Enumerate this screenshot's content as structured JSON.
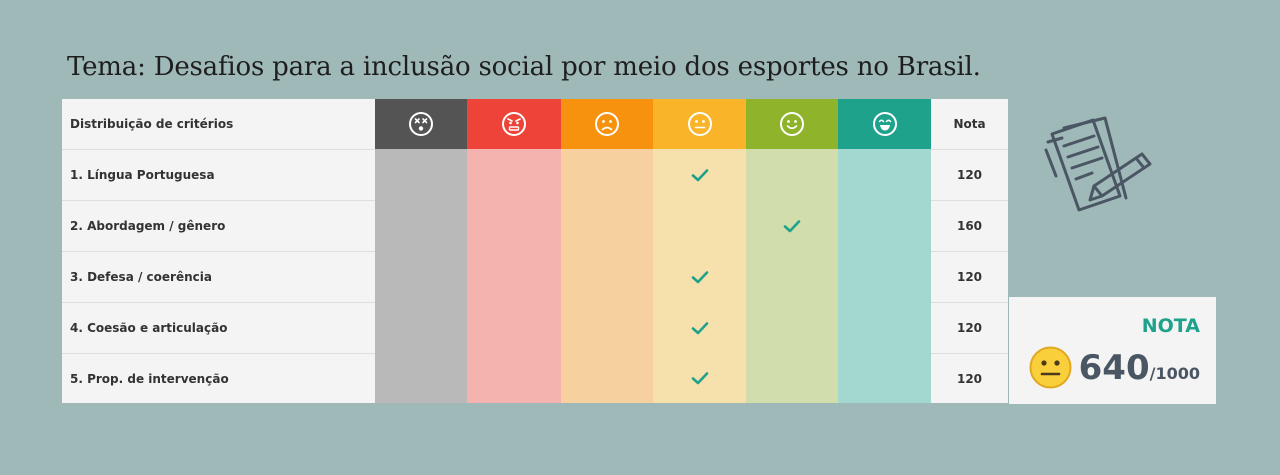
{
  "title": "Tema:  Desafios para a inclusão social por meio dos esportes no Brasil.",
  "table": {
    "header_label": "Distribuição de critérios",
    "nota_label": "Nota",
    "levels": [
      {
        "icon": "dizzy-face-icon",
        "header_color": "#545454",
        "cell_color": "#b9b9b9"
      },
      {
        "icon": "angry-face-icon",
        "header_color": "#ee4338",
        "cell_color": "#f4b3ae"
      },
      {
        "icon": "sad-face-icon",
        "header_color": "#f7920f",
        "cell_color": "#f7d09f"
      },
      {
        "icon": "neutral-face-icon",
        "header_color": "#f9b42a",
        "cell_color": "#f6e0ab"
      },
      {
        "icon": "smile-face-icon",
        "header_color": "#8fb32a",
        "cell_color": "#d1ddaa"
      },
      {
        "icon": "laugh-face-icon",
        "header_color": "#1ea28c",
        "cell_color": "#a3d8d0"
      }
    ],
    "rows": [
      {
        "label": "1. Língua Portuguesa",
        "checked_level": 3,
        "nota": "120"
      },
      {
        "label": "2. Abordagem / gênero",
        "checked_level": 4,
        "nota": "160"
      },
      {
        "label": "3. Defesa / coerência",
        "checked_level": 3,
        "nota": "120"
      },
      {
        "label": "4. Coesão e articulação",
        "checked_level": 3,
        "nota": "120"
      },
      {
        "label": "5. Prop. de intervenção",
        "checked_level": 3,
        "nota": "120"
      }
    ]
  },
  "summary": {
    "label": "NOTA",
    "score": "640",
    "max": "/1000",
    "icon": "neutral-face-icon"
  },
  "decor_icon": "notes-pencil-icon",
  "colors": {
    "background": "#9fb8b8",
    "accent": "#1ea28c",
    "check": "#1ea28c"
  }
}
